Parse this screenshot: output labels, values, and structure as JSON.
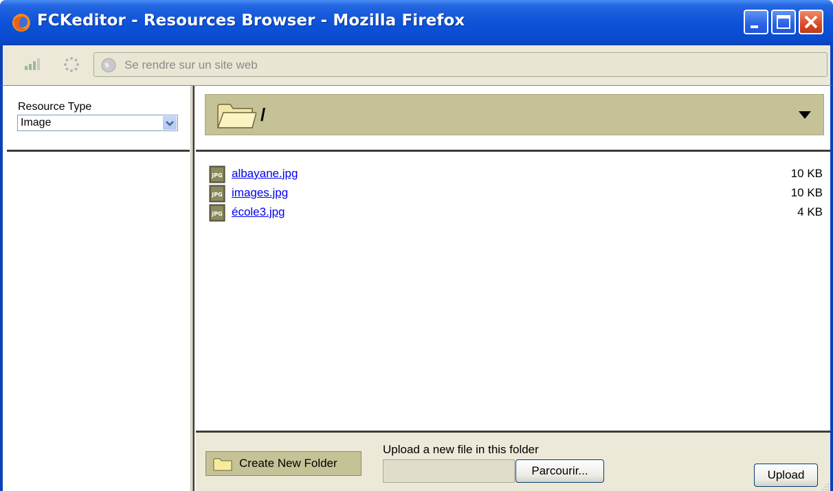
{
  "window": {
    "title": "FCKeditor - Resources Browser - Mozilla Firefox",
    "controls": [
      "minimize",
      "maximize",
      "close"
    ]
  },
  "navbar": {
    "url_placeholder": "Se rendre sur un site web"
  },
  "sidebar": {
    "resource_type_label": "Resource Type",
    "resource_type_value": "Image"
  },
  "folder": {
    "path": "/"
  },
  "files": [
    {
      "name": "albayane.jpg",
      "size": "10 KB",
      "icon": "jpg-file-icon"
    },
    {
      "name": "images.jpg",
      "size": "10 KB",
      "icon": "jpg-file-icon"
    },
    {
      "name": "école3.jpg",
      "size": "4 KB",
      "icon": "jpg-file-icon"
    }
  ],
  "bottom": {
    "create_folder_label": "Create New Folder",
    "upload_label": "Upload a new file in this folder",
    "browse_label": "Parcourir...",
    "upload_button_label": "Upload"
  },
  "colors": {
    "titlebar": "#0a4cd0",
    "chrome": "#ece9d8",
    "folder_bar": "#c5c297",
    "link": "#0000ee"
  }
}
